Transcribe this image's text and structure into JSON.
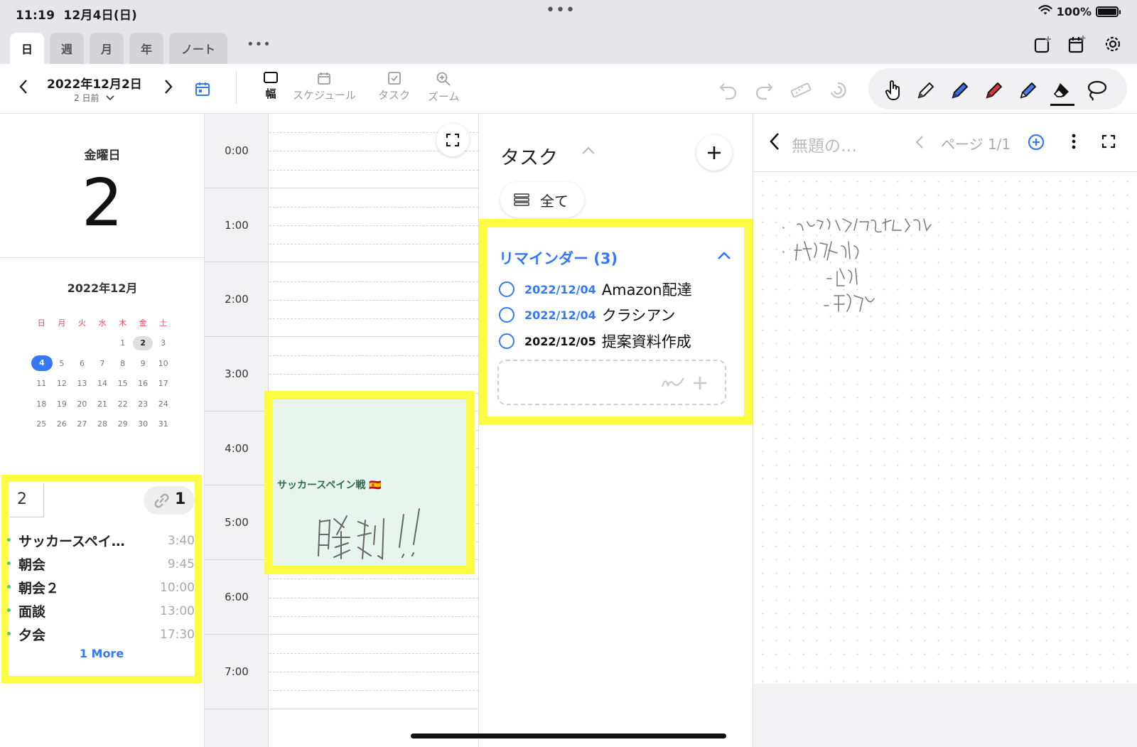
{
  "status": {
    "time": "11:19",
    "date": "12月4日(日)",
    "battery": "100%"
  },
  "tabs": [
    {
      "label": "日",
      "active": true
    },
    {
      "label": "週",
      "active": false
    },
    {
      "label": "月",
      "active": false
    },
    {
      "label": "年",
      "active": false
    },
    {
      "label": "ノート",
      "active": false
    }
  ],
  "tab_more": "•••",
  "header": {
    "date": "2022年12月2日",
    "relative": "2 日前"
  },
  "toolbar": {
    "width_label": "幅",
    "schedule_label": "スケジュール",
    "task_label": "タスク",
    "zoom_label": "ズーム"
  },
  "left": {
    "weekday": "金曜日",
    "day": "2",
    "month_title": "2022年12月",
    "weekdays": [
      "日",
      "月",
      "火",
      "水",
      "木",
      "金",
      "土"
    ],
    "weeks": [
      [
        "",
        "",
        "",
        "",
        "1",
        "2",
        "3"
      ],
      [
        "4",
        "5",
        "6",
        "7",
        "8",
        "9",
        "10"
      ],
      [
        "11",
        "12",
        "13",
        "14",
        "15",
        "16",
        "17"
      ],
      [
        "18",
        "19",
        "20",
        "21",
        "22",
        "23",
        "24"
      ],
      [
        "25",
        "26",
        "27",
        "28",
        "29",
        "30",
        "31"
      ]
    ],
    "selected_day": "2",
    "today": "4",
    "day_box": {
      "day": "2",
      "link_count": "1",
      "events": [
        {
          "name": "サッカースペイ…",
          "time": "3:40"
        },
        {
          "name": "朝会",
          "time": "9:45"
        },
        {
          "name": "朝会２",
          "time": "10:00"
        },
        {
          "name": "面談",
          "time": "13:00"
        },
        {
          "name": "夕会",
          "time": "17:30"
        }
      ],
      "more": "1 More"
    }
  },
  "timeline": {
    "hours": [
      "0:00",
      "1:00",
      "2:00",
      "3:00",
      "4:00",
      "5:00",
      "6:00",
      "7:00"
    ],
    "event": {
      "title": "サッカースペイン戦",
      "flag": "🇪🇸"
    }
  },
  "tasks": {
    "title": "タスク",
    "filter": "全て",
    "reminders": {
      "header": "リマインダー (3)",
      "items": [
        {
          "date": "2022/12/04",
          "text": "Amazon配達",
          "date_dark": false
        },
        {
          "date": "2022/12/04",
          "text": "クラシアン",
          "date_dark": false
        },
        {
          "date": "2022/12/05",
          "text": "提案資料作成",
          "date_dark": true
        }
      ]
    }
  },
  "note": {
    "title": "無題の…",
    "page": "ページ 1/1"
  },
  "colors": {
    "accent": "#3478f6",
    "highlight": "#fcfc43",
    "event_bg": "#e8f5ef"
  }
}
